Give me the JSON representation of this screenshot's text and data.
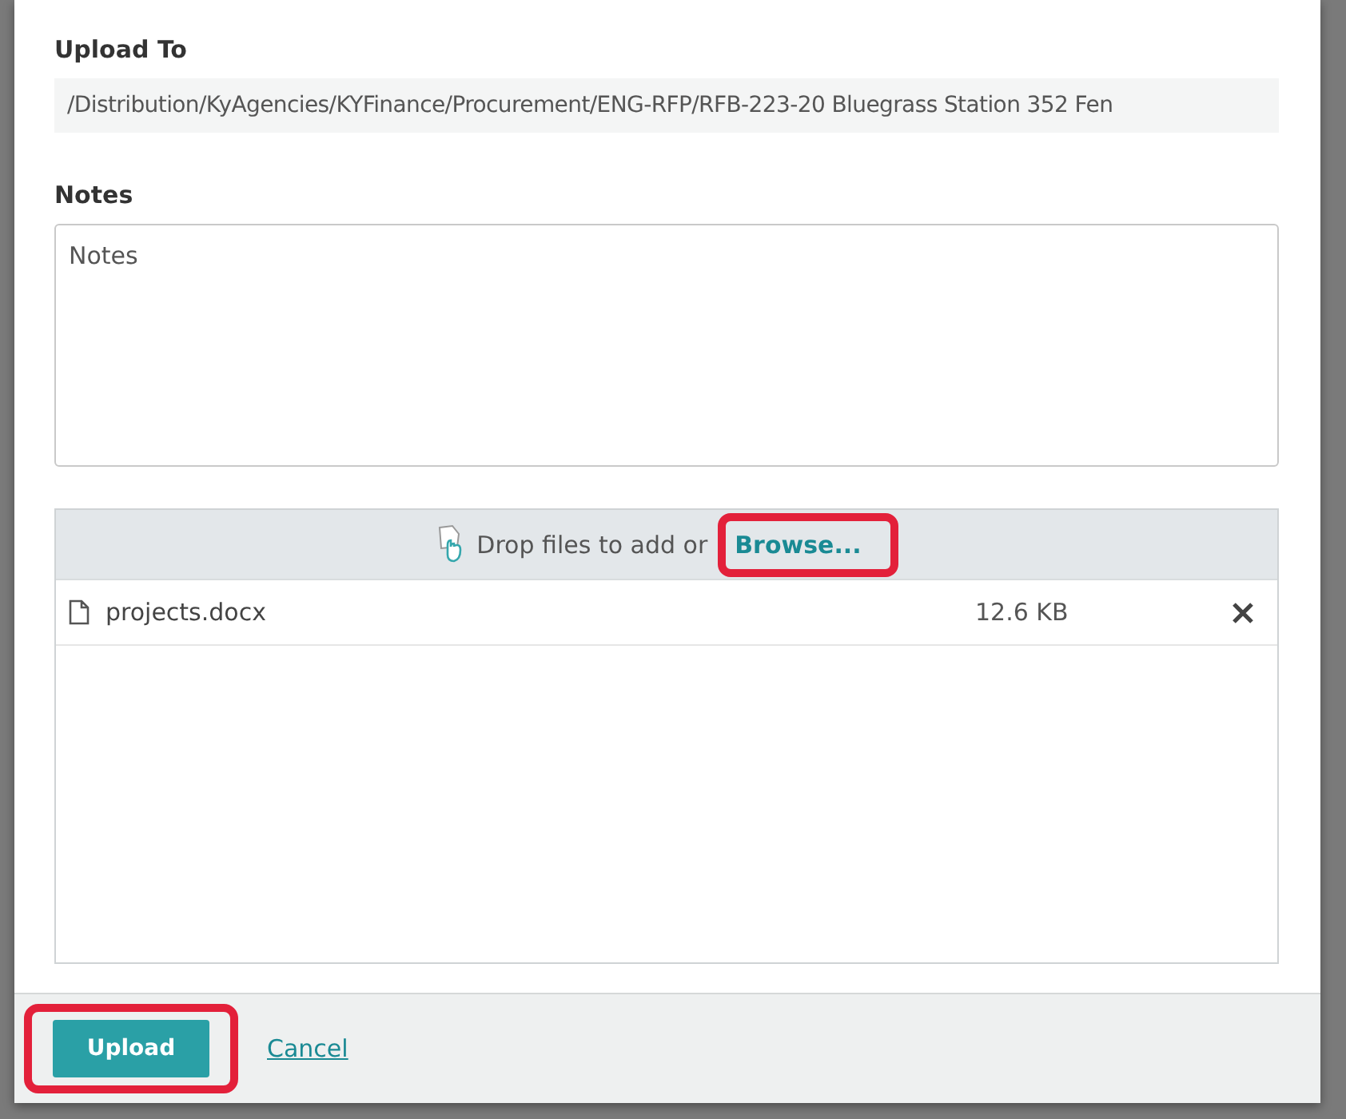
{
  "upload_to": {
    "label": "Upload To",
    "path": "/Distribution/KyAgencies/KYFinance/Procurement/ENG-RFP/RFB-223-20 Bluegrass Station 352 Fen"
  },
  "notes": {
    "label": "Notes",
    "placeholder": "Notes"
  },
  "dropzone": {
    "prompt": "Drop files to add or",
    "browse": "Browse...",
    "annotated": true
  },
  "files": [
    {
      "name": "projects.docx",
      "size": "12.6 KB"
    }
  ],
  "footer": {
    "upload": "Upload",
    "cancel": "Cancel",
    "upload_annotated": true
  }
}
